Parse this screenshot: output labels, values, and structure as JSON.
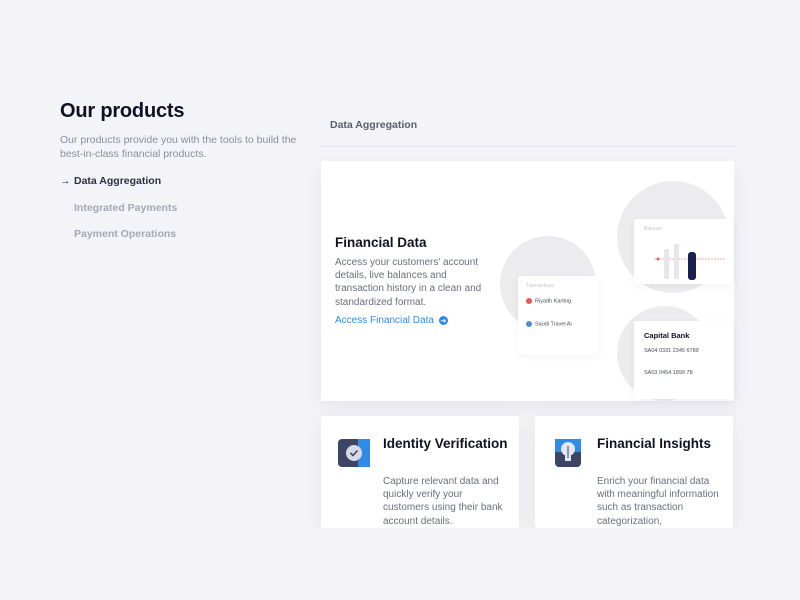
{
  "intro": {
    "title": "Our products",
    "description": "Our products provide you with the tools to build the best-in-class financial products."
  },
  "nav": {
    "items": [
      {
        "label": "Data Aggregation",
        "active": true
      },
      {
        "label": "Integrated Payments",
        "active": false
      },
      {
        "label": "Payment Operations",
        "active": false
      }
    ]
  },
  "tab": {
    "label": "Data Aggregation"
  },
  "main_card": {
    "title": "Financial Data",
    "description": "Access your customers' account details, live balances and transaction history in a clean and standardized format.",
    "link_label": "Access Financial Data",
    "illustration": {
      "transactions_title": "Transactions",
      "merchant_1": "Riyadh Karting",
      "merchant_2": "Saudi Travel Ai",
      "balance_title": "Balance",
      "bank_name": "Capital Bank",
      "iban_1": "SA04 0331 2345 6789",
      "iban_2": "SA03 0454 1899 78"
    }
  },
  "cards": [
    {
      "title": "Identity Verification",
      "description": "Capture relevant data and quickly verify your customers using their bank account details.",
      "icon": "verified-badge-icon"
    },
    {
      "title": "Financial Insights",
      "description": "Enrich your financial data with meaningful information such as transaction categorization,",
      "icon": "lightbulb-icon"
    }
  ],
  "colors": {
    "accent": "#2f8be6",
    "dark": "#0f1222",
    "muted": "#8a8d9c"
  }
}
